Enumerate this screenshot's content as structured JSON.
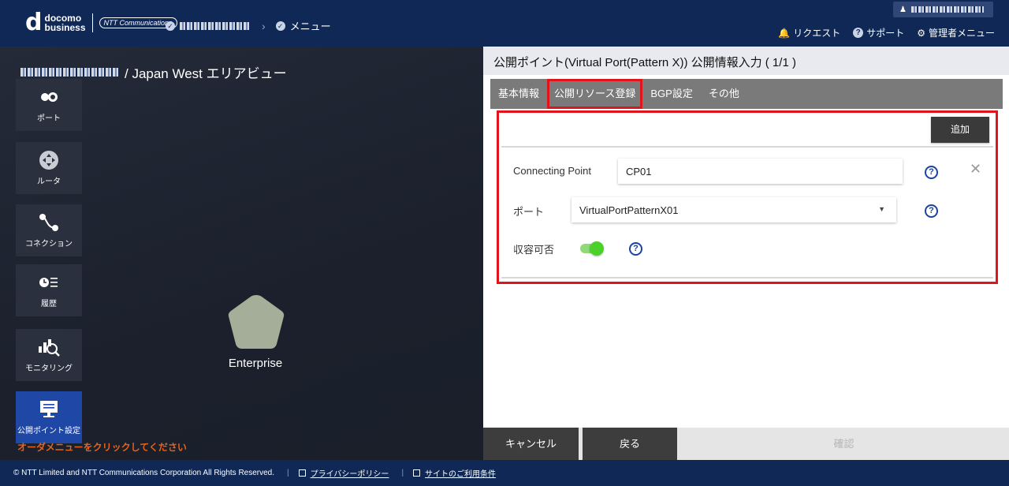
{
  "header": {
    "logo_top": "docomo",
    "logo_bottom": "business",
    "ntt_logo": "NTT Communications",
    "crumb_menu": "メニュー",
    "menu": {
      "request": "リクエスト",
      "support": "サポート",
      "admin_menu": "管理者メニュー"
    }
  },
  "left": {
    "area_title": "/ Japan West エリアビュー",
    "side_buttons": [
      {
        "label": "ポート",
        "icon": "port-icon"
      },
      {
        "label": "ルータ",
        "icon": "router-icon"
      },
      {
        "label": "コネクション",
        "icon": "connection-icon"
      },
      {
        "label": "履歴",
        "icon": "history-icon"
      },
      {
        "label": "モニタリング",
        "icon": "monitoring-icon"
      },
      {
        "label": "公開ポイント設定",
        "icon": "public-point-icon"
      }
    ],
    "node_label": "Enterprise",
    "order_hint": "オーダメニューをクリックしてください"
  },
  "panel": {
    "title": "公開ポイント(Virtual Port(Pattern X)) 公開情報入力 ( 1/1 )",
    "tabs": [
      "基本情報",
      "公開リソース登録",
      "BGP設定",
      "その他"
    ],
    "active_tab": 1,
    "add_label": "追加",
    "fields": {
      "connecting_point_label": "Connecting Point",
      "connecting_point_value": "CP01",
      "port_label": "ポート",
      "port_value": "VirtualPortPatternX01",
      "capacity_label": "収容可否",
      "capacity_on": true
    },
    "buttons": {
      "cancel": "キャンセル",
      "back": "戻る",
      "confirm": "確認"
    }
  },
  "footer": {
    "copyright": "© NTT Limited and NTT Communications Corporation All Rights Reserved.",
    "privacy": "プライバシーポリシー",
    "terms": "サイトのご利用条件"
  },
  "colors": {
    "header_bg": "#0f2856",
    "highlight": "#e0141a",
    "toggle_on": "#4cd02a",
    "help": "#1a44a0"
  }
}
